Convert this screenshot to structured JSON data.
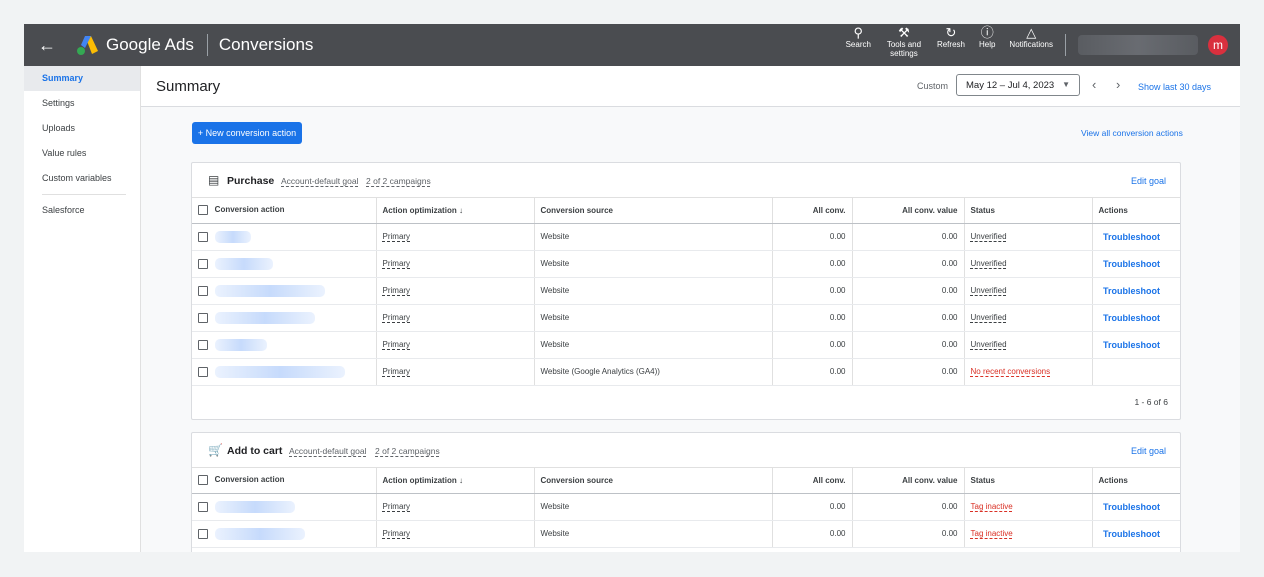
{
  "topbar": {
    "app_name": "Google Ads",
    "page_title": "Conversions",
    "tools": [
      {
        "icon": "search-icon",
        "label": "Search"
      },
      {
        "icon": "wrench-icon",
        "label": "Tools and settings"
      },
      {
        "icon": "refresh-icon",
        "label": "Refresh"
      },
      {
        "icon": "help-icon",
        "label": "Help"
      },
      {
        "icon": "bell-icon",
        "label": "Notifications"
      }
    ],
    "avatar_letter": "m"
  },
  "sidebar": {
    "items": [
      "Summary",
      "Settings",
      "Uploads",
      "Value rules",
      "Custom variables",
      "Salesforce"
    ]
  },
  "header": {
    "title": "Summary",
    "custom_label": "Custom",
    "date_range": "May 12 – Jul 4, 2023",
    "show_last": "Show last 30 days"
  },
  "actions": {
    "new_button": "+ New conversion action",
    "view_all": "View all conversion actions"
  },
  "columns": [
    "Conversion action",
    "Action optimization",
    "Conversion source",
    "All conv.",
    "All conv. value",
    "Status",
    "Actions"
  ],
  "goals": [
    {
      "name": "Purchase",
      "goal_type": "Account-default goal",
      "campaigns": "2 of 2 campaigns",
      "edit": "Edit goal",
      "rows": [
        {
          "optimization": "Primary",
          "source": "Website",
          "all_conv": "0.00",
          "value": "0.00",
          "status": "Unverified",
          "action": "Troubleshoot"
        },
        {
          "optimization": "Primary",
          "source": "Website",
          "all_conv": "0.00",
          "value": "0.00",
          "status": "Unverified",
          "action": "Troubleshoot"
        },
        {
          "optimization": "Primary",
          "source": "Website",
          "all_conv": "0.00",
          "value": "0.00",
          "status": "Unverified",
          "action": "Troubleshoot"
        },
        {
          "optimization": "Primary",
          "source": "Website",
          "all_conv": "0.00",
          "value": "0.00",
          "status": "Unverified",
          "action": "Troubleshoot"
        },
        {
          "optimization": "Primary",
          "source": "Website",
          "all_conv": "0.00",
          "value": "0.00",
          "status": "Unverified",
          "action": "Troubleshoot"
        },
        {
          "optimization": "Primary",
          "source": "Website (Google Analytics (GA4))",
          "all_conv": "0.00",
          "value": "0.00",
          "status": "No recent conversions",
          "action": ""
        }
      ],
      "pager": "1 - 6 of 6"
    },
    {
      "name": "Add to cart",
      "goal_type": "Account-default goal",
      "campaigns": "2 of 2 campaigns",
      "edit": "Edit goal",
      "rows": [
        {
          "optimization": "Primary",
          "source": "Website",
          "all_conv": "0.00",
          "value": "0.00",
          "status": "Tag inactive",
          "action": "Troubleshoot"
        },
        {
          "optimization": "Primary",
          "source": "Website",
          "all_conv": "0.00",
          "value": "0.00",
          "status": "Tag inactive",
          "action": "Troubleshoot"
        }
      ]
    }
  ],
  "colors": {
    "topbar": "#4a4c50",
    "accent": "#1a73e8",
    "error": "#d93025"
  }
}
